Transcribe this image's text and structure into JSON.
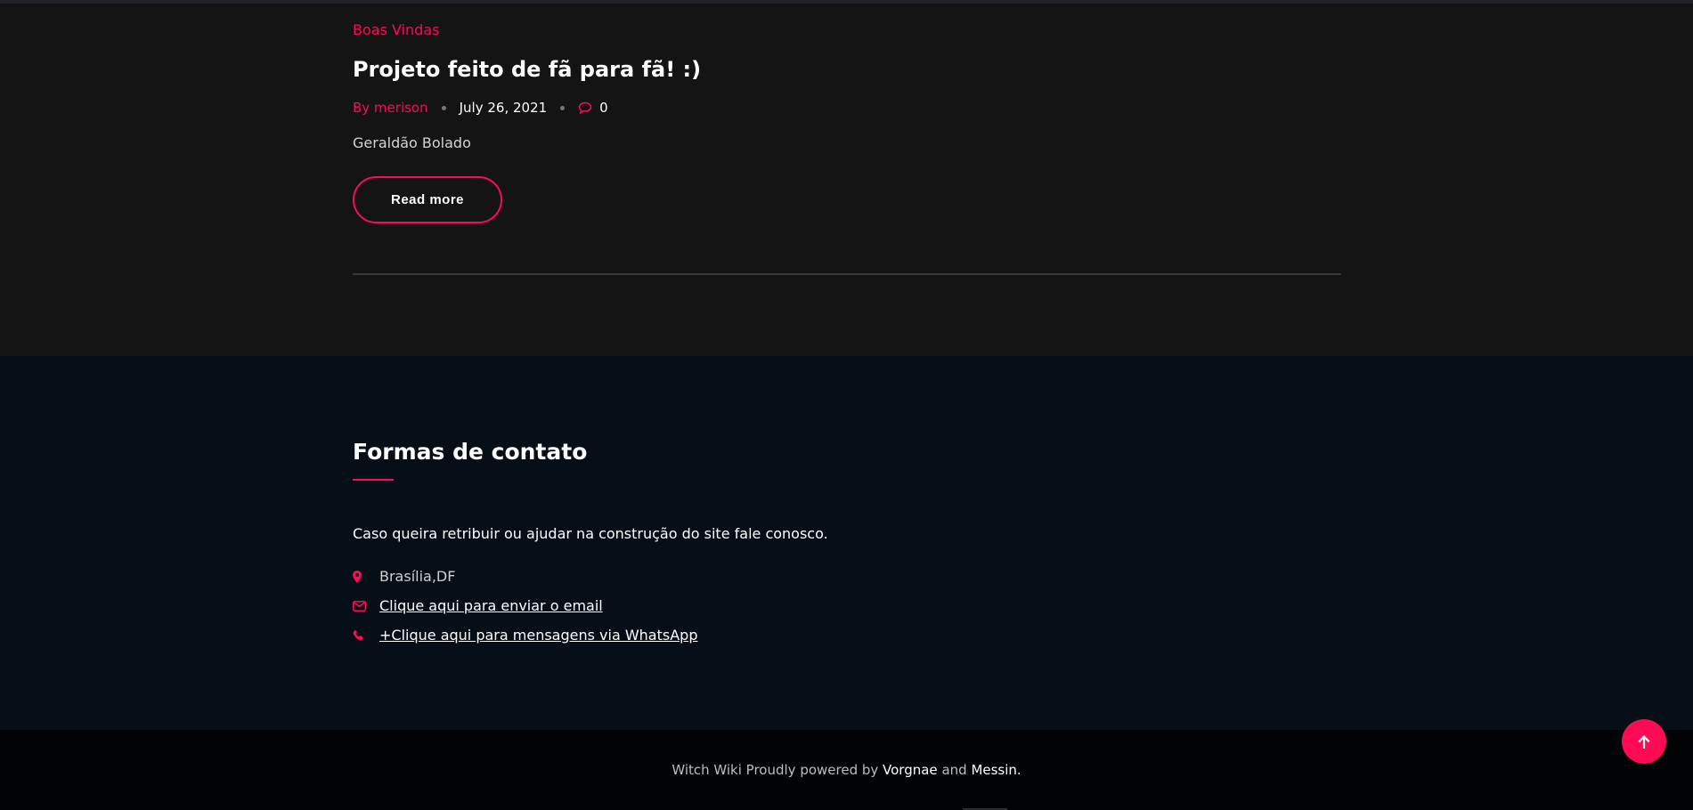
{
  "post": {
    "category": "Boas Vindas",
    "title": "Projeto feito de fã para fã! :)",
    "author": "By merison",
    "date": "July 26, 2021",
    "comments": "0",
    "excerpt": "Geraldão Bolado",
    "read_more": "Read more"
  },
  "contact": {
    "title": "Formas de contato",
    "text": "Caso queira retribuir ou ajudar na construção do site fale conosco.",
    "items": [
      {
        "icon": "map-marker-icon",
        "label": "Brasília,DF"
      },
      {
        "icon": "envelope-icon",
        "label": "Clique aqui para enviar o email"
      },
      {
        "icon": "phone-icon",
        "label": "+Clique aqui para mensagens via WhatsApp"
      }
    ]
  },
  "footer": {
    "prefix": "Witch Wiki Proudly powered by ",
    "link1": "Vorgnae",
    "middle": " and ",
    "link2": "Messin."
  },
  "colors": {
    "accent": "#ff0a54",
    "post_bg": "#141414",
    "contact_bg": "#060e18",
    "footer_bg": "#010306"
  }
}
